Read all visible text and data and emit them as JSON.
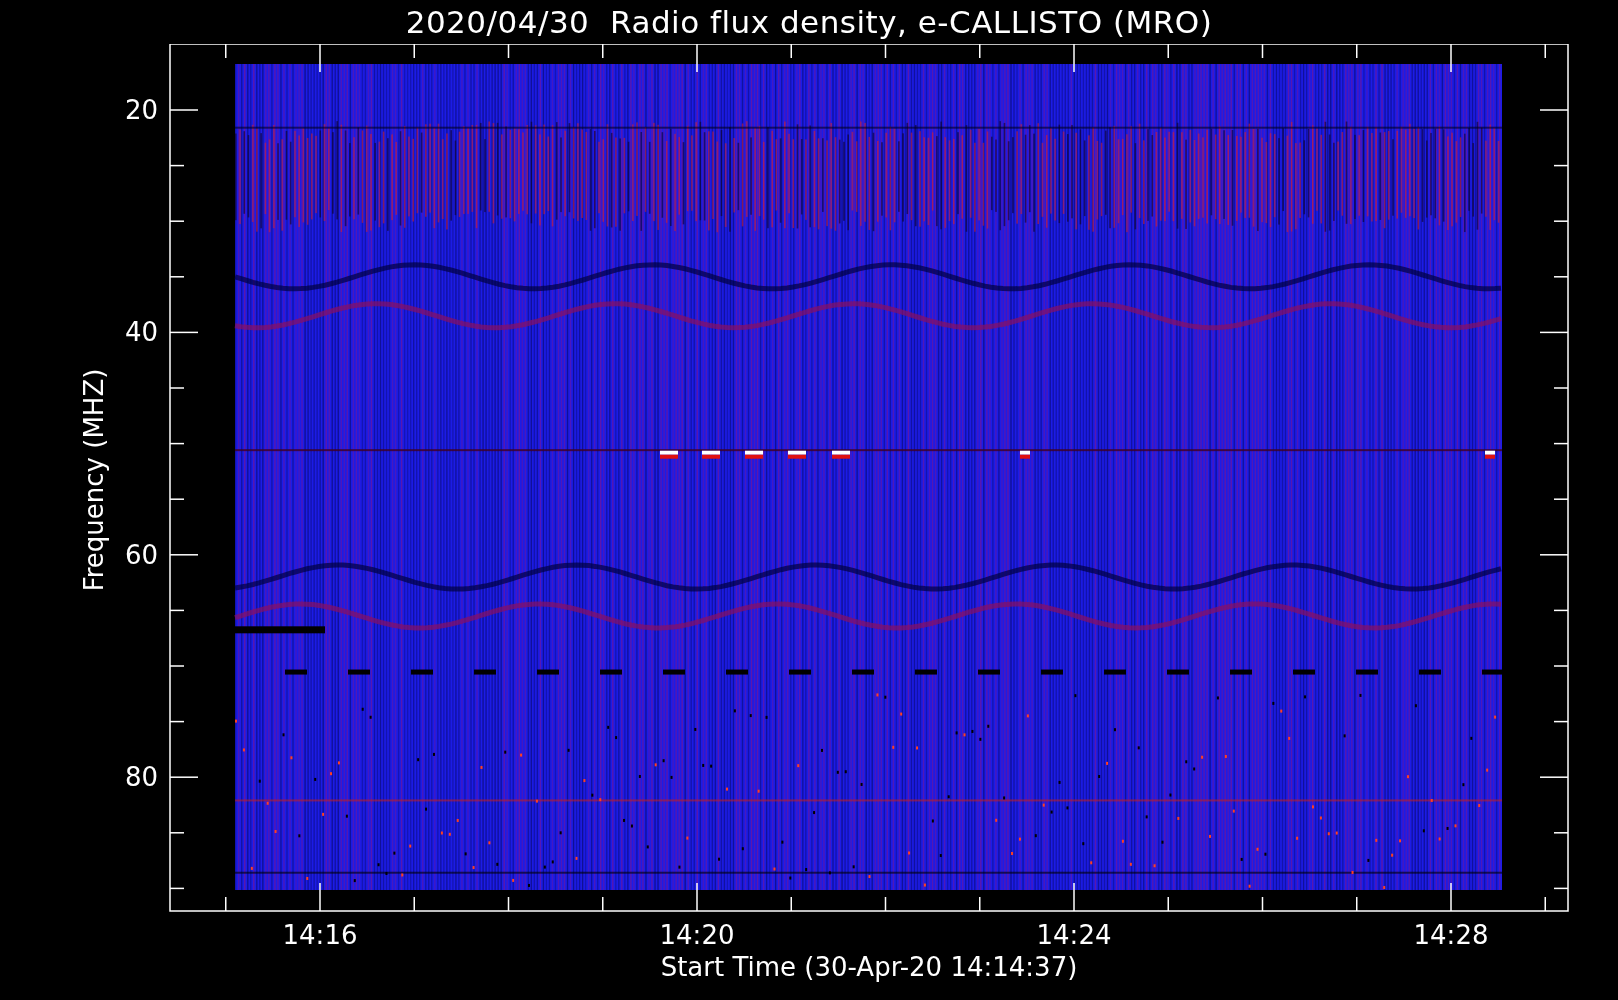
{
  "title": "2020/04/30  Radio flux density, e-CALLISTO (MRO)",
  "y_axis": {
    "label": "Frequency (MHZ)",
    "ticks": [
      "20",
      "40",
      "60",
      "80"
    ]
  },
  "x_axis": {
    "label": "Start Time (30-Apr-20 14:14:37)",
    "ticks": [
      "14:16",
      "14:20",
      "14:24",
      "14:28"
    ]
  }
}
